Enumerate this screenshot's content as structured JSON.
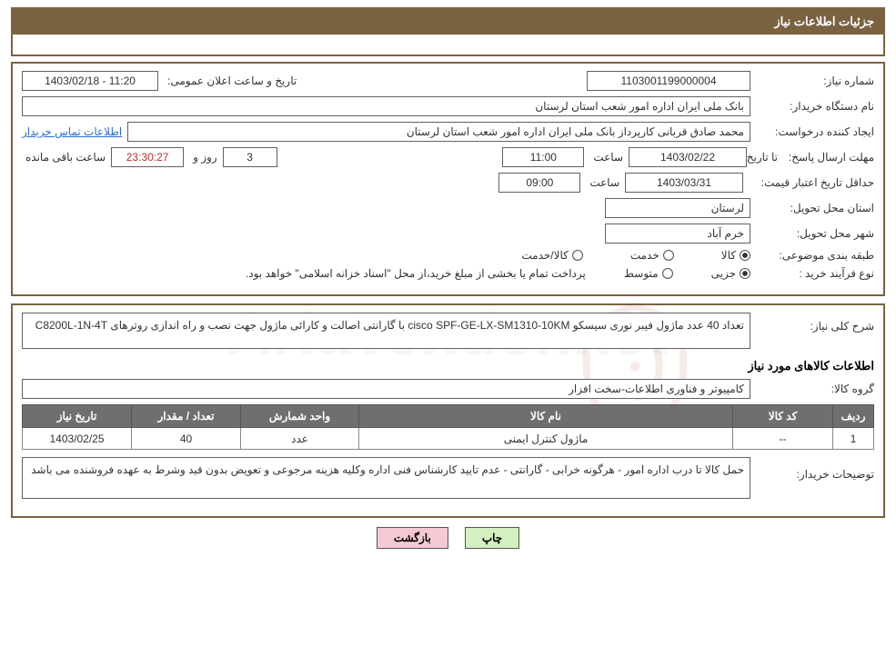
{
  "header": {
    "title": "جزئیات اطلاعات نیاز"
  },
  "panel1": {
    "need_number_label": "شماره نیاز:",
    "need_number": "1103001199000004",
    "announce_label": "تاریخ و ساعت اعلان عمومی:",
    "announce_value": "11:20 - 1403/02/18",
    "buyer_org_label": "نام دستگاه خریدار:",
    "buyer_org": "بانک ملی ایران اداره امور شعب استان لرستان",
    "requester_label": "ایجاد کننده درخواست:",
    "requester": "محمد صادق  قربانی   کارپرداز بانک ملی ایران اداره امور شعب استان لرستان",
    "contact_link": "اطلاعات تماس خریدار",
    "deadline_label": "مهلت ارسال پاسخ:",
    "ta_date_label": "تا تاریخ:",
    "deadline_date": "1403/02/22",
    "time_label": "ساعت",
    "deadline_time": "11:00",
    "days_value": "3",
    "days_label": "روز و",
    "timer": "23:30:27",
    "remaining_label": "ساعت باقی مانده",
    "validity_label": "حداقل تاریخ اعتبار قیمت:",
    "validity_date": "1403/03/31",
    "validity_time": "09:00",
    "province_label": "استان محل تحویل:",
    "province": "لرستان",
    "city_label": "شهر محل تحویل:",
    "city": "خرم آباد",
    "classify_label": "طبقه بندی موضوعی:",
    "classify_kala": "کالا",
    "classify_khadmat": "خدمت",
    "classify_kala_khadmat": "کالا/خدمت",
    "purchase_type_label": "نوع فرآیند خرید :",
    "purchase_partial": "جزیی",
    "purchase_medium": "متوسط",
    "purchase_note": "پرداخت تمام یا بخشی از مبلغ خرید،از محل \"اسناد خزانه اسلامی\" خواهد بود."
  },
  "panel2": {
    "desc_label": "شرح کلی نیاز:",
    "desc_value": "تعداد 40 عدد ماژول فیبر نوری سیسکو cisco  SPF-GE-LX-SM1310-10KM با گارانتی اصالت و کارائی ماژول جهت نصب و راه اندازی روترهای   C8200L-1N-4T",
    "items_title": "اطلاعات کالاهای مورد نیاز",
    "group_label": "گروه کالا:",
    "group_value": "کامپیوتر و فناوری اطلاعات-سخت افزار",
    "table": {
      "headers": {
        "row": "ردیف",
        "code": "کد کالا",
        "name": "نام کالا",
        "unit": "واحد شمارش",
        "qty": "تعداد / مقدار",
        "date": "تاریخ نیاز"
      },
      "rows": [
        {
          "row": "1",
          "code": "--",
          "name": "ماژول کنترل ایمنی",
          "unit": "عدد",
          "qty": "40",
          "date": "1403/02/25"
        }
      ]
    },
    "notes_label": "توضیحات خریدار:",
    "notes_value": "حمل کالا تا درب اداره امور - هرگونه خرابی - گارانتی - عدم تایید کارشناس فنی اداره وکلیه هزینه مرجوعی و تعویض بدون قید وشرط به عهده فروشنده می باشد"
  },
  "actions": {
    "print": "چاپ",
    "back": "بازگشت"
  }
}
